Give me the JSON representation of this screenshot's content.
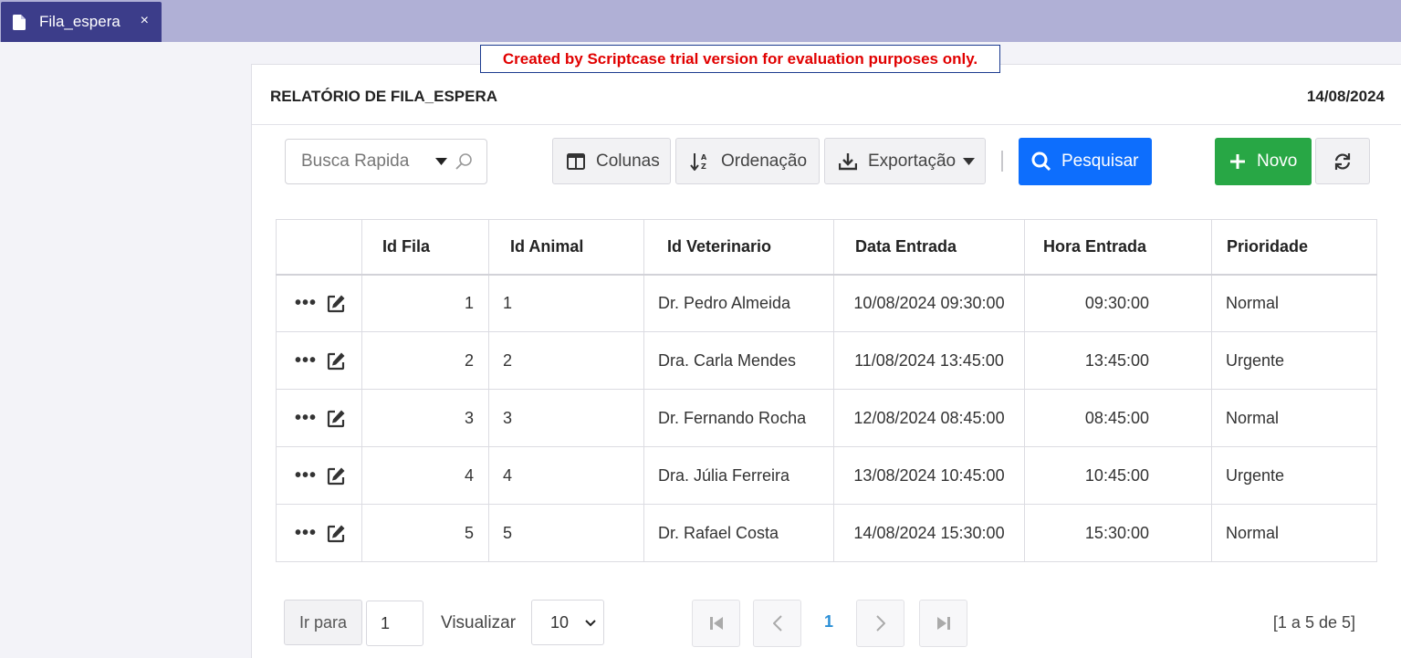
{
  "tab": {
    "label": "Fila_espera",
    "close": "×",
    "icon": "document-icon"
  },
  "trial_banner": "Created by Scriptcase trial version for evaluation purposes only.",
  "header": {
    "title": "RELATÓRIO DE FILA_ESPERA",
    "date": "14/08/2024"
  },
  "toolbar": {
    "search_placeholder": "Busca Rapida",
    "colunas": "Colunas",
    "ordenacao": "Ordenação",
    "exportacao": "Exportação",
    "pesquisar": "Pesquisar",
    "novo": "Novo"
  },
  "table": {
    "headers": [
      "Id Fila",
      "Id Animal",
      "Id Veterinario",
      "Data Entrada",
      "Hora Entrada",
      "Prioridade"
    ],
    "rows": [
      [
        "1",
        "1",
        "Dr. Pedro Almeida",
        "10/08/2024 09:30:00",
        "09:30:00",
        "Normal"
      ],
      [
        "2",
        "2",
        "Dra. Carla Mendes",
        "11/08/2024 13:45:00",
        "13:45:00",
        "Urgente"
      ],
      [
        "3",
        "3",
        "Dr. Fernando Rocha",
        "12/08/2024 08:45:00",
        "08:45:00",
        "Normal"
      ],
      [
        "4",
        "4",
        "Dra. Júlia Ferreira",
        "13/08/2024 10:45:00",
        "10:45:00",
        "Urgente"
      ],
      [
        "5",
        "5",
        "Dr. Rafael Costa",
        "14/08/2024 15:30:00",
        "15:30:00",
        "Normal"
      ]
    ]
  },
  "footer": {
    "ir_para": "Ir para",
    "page_input": "1",
    "visualizar": "Visualizar",
    "page_size": "10",
    "current_page": "1",
    "summary": "[1 a 5 de 5]"
  },
  "colors": {
    "primary": "#0d6efd",
    "success": "#28a745",
    "tab": "#3c3d8a",
    "tabbar": "#b0b0d6",
    "trial": "#e10000"
  }
}
